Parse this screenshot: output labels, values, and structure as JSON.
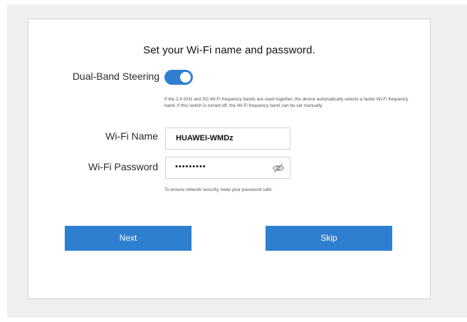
{
  "setup": {
    "title": "Set your Wi-Fi name and password.",
    "dual_band": {
      "label": "Dual-Band Steering",
      "enabled": true,
      "hint": "If the 2.4 GHz and 5G Wi-Fi frequency bands are used together, the device automatically selects a faster Wi-Fi frequency band. If this switch is turned off, the Wi-Fi frequency band can be set manually."
    },
    "wifi_name": {
      "label": "Wi-Fi Name",
      "value": "HUAWEI-WMDz"
    },
    "wifi_password": {
      "label": "Wi-Fi Password",
      "value": "•••••••••",
      "visibility_icon": "eye-off-icon",
      "note": "To ensure network security, keep your password safe."
    },
    "buttons": {
      "next": "Next",
      "skip": "Skip"
    }
  },
  "colors": {
    "accent": "#2f7fd0",
    "backdrop": "#f0f0f1",
    "card": "#ffffff"
  }
}
